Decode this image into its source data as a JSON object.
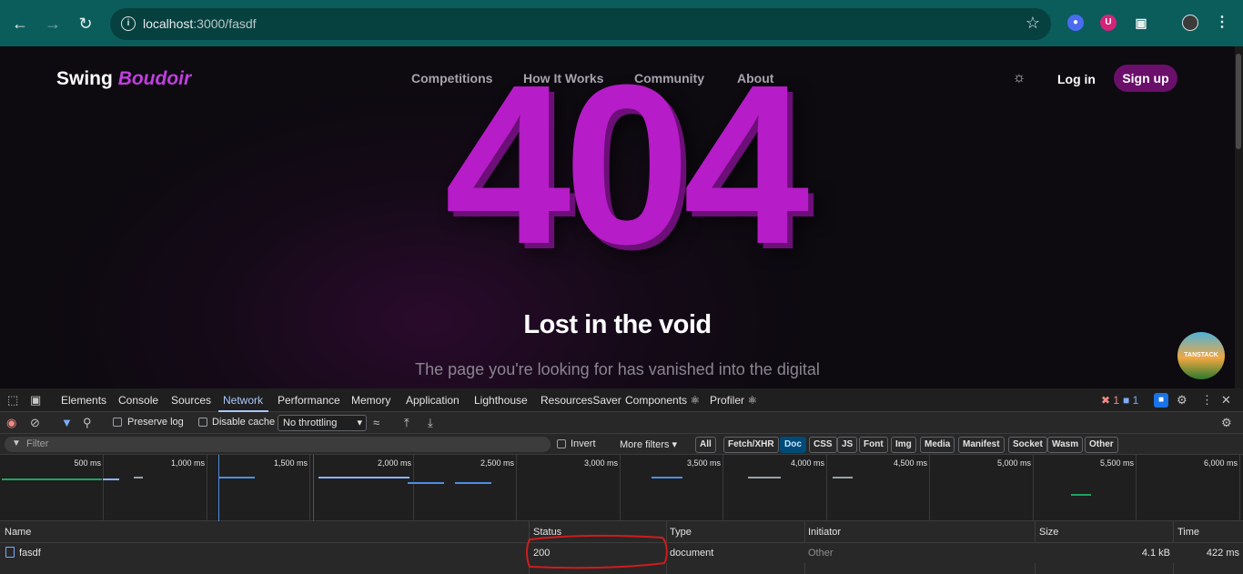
{
  "browser": {
    "url_host": "localhost",
    "url_path": ":3000/fasdf"
  },
  "site": {
    "logo_main": "Swing",
    "logo_accent": "Boudoir",
    "nav": [
      "Competitions",
      "How It Works",
      "Community",
      "About"
    ],
    "login": "Log in",
    "signup": "Sign up",
    "error_code": "404",
    "heading": "Lost in the void",
    "subtext": "The page you're looking for has vanished into the digital",
    "devtools_badge": "TANSTACK"
  },
  "devtools": {
    "tabs": [
      "Elements",
      "Console",
      "Sources",
      "Network",
      "Performance",
      "Memory",
      "Application",
      "Lighthouse",
      "ResourcesSaver",
      "Components ⚛",
      "Profiler ⚛"
    ],
    "active_tab": "Network",
    "error_count": "1",
    "message_count": "1",
    "toolbar": {
      "preserve_log": "Preserve log",
      "disable_cache": "Disable cache",
      "throttling": "No throttling"
    },
    "filter": {
      "placeholder": "Filter",
      "invert": "Invert",
      "more_filters": "More filters",
      "types": [
        "All",
        "Fetch/XHR",
        "Doc",
        "CSS",
        "JS",
        "Font",
        "Img",
        "Media",
        "Manifest",
        "Socket",
        "Wasm",
        "Other"
      ],
      "active_type": "Doc"
    },
    "timeline_ticks": [
      "500 ms",
      "1,000 ms",
      "1,500 ms",
      "2,000 ms",
      "2,500 ms",
      "3,000 ms",
      "3,500 ms",
      "4,000 ms",
      "4,500 ms",
      "5,000 ms",
      "5,500 ms",
      "6,000 ms"
    ],
    "columns": [
      "Name",
      "Status",
      "Type",
      "Initiator",
      "Size",
      "Time"
    ],
    "rows": [
      {
        "name": "fasdf",
        "status": "200",
        "type": "document",
        "initiator": "Other",
        "size": "4.1 kB",
        "time": "422 ms"
      }
    ]
  },
  "colors": {
    "accent": "#b61cc7",
    "chrome": "#0b5d5c",
    "annotation": "#d01c1c"
  }
}
